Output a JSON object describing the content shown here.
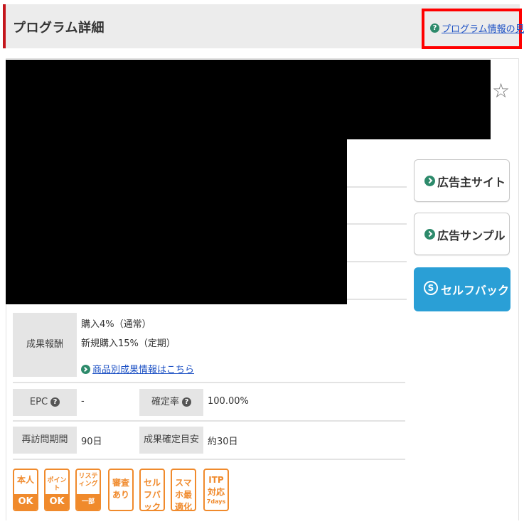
{
  "header": {
    "title": "プログラム詳細",
    "guide_link": "プログラム情報の見方",
    "guide_icon": "question-circle-icon"
  },
  "side_buttons": {
    "advertiser_site": "広告主サイト",
    "ad_sample": "広告サンプル",
    "selfback": "セルフバック"
  },
  "reward": {
    "label": "成果報酬",
    "line1": "購入4%（通常）",
    "line2": "新規購入15%（定期）",
    "link": "商品別成果情報はこちら"
  },
  "stats": {
    "epc_label": "EPC",
    "epc_value": "-",
    "confirm_rate_label": "確定率",
    "confirm_rate_value": "100.00%",
    "revisit_label": "再訪問期間",
    "revisit_value": "90日",
    "confirm_period_label": "成果確定目安",
    "confirm_period_value": "約30日"
  },
  "badges": [
    {
      "top": "本人",
      "bottom": "OK"
    },
    {
      "top": "ポイント",
      "bottom": "OK"
    },
    {
      "top": "リスティング",
      "bottom": "一部OK"
    },
    {
      "top": "審査あり"
    },
    {
      "top": "セルフバック"
    },
    {
      "top": "スマホ最適化"
    },
    {
      "top": "ITP対応",
      "sub": "7days"
    }
  ],
  "colors": {
    "accent_red": "#c4161c",
    "link_blue": "#1a4fc4",
    "selfback_blue": "#2a9fd6",
    "badge_orange": "#f08a2c",
    "arrow_green": "#2d8a6b"
  }
}
